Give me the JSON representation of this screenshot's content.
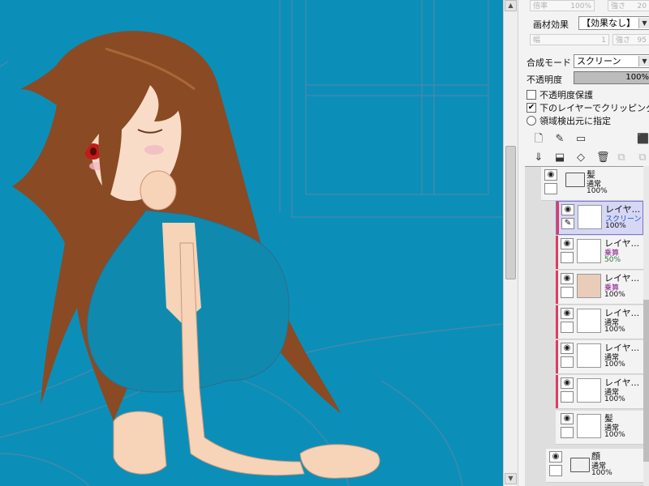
{
  "window": {
    "bg_color": "#0b8fb8"
  },
  "panel": {
    "top_labels": {
      "bairitsu": "倍率",
      "bairitsu_val": "100%",
      "tsuyosa": "強さ",
      "tsuyosa_val": "20"
    },
    "texture_effect": {
      "label": "画材効果",
      "value": "【効果なし】"
    },
    "width_row": {
      "haba": "幅",
      "haba_val": "1",
      "tsuyosa": "強さ",
      "tsuyosa_val": "95"
    },
    "blend_mode": {
      "label": "合成モード",
      "value": "スクリーン"
    },
    "opacity": {
      "label": "不透明度",
      "value": "100%"
    },
    "opts": {
      "protect": {
        "label": "不透明度保護",
        "checked": ""
      },
      "clip": {
        "label": "下のレイヤーでクリッピング",
        "checked": "✔"
      },
      "source": {
        "label": "領域検出元に指定"
      }
    },
    "layers": [
      {
        "name": "髪",
        "mode": "通常",
        "opacity": "100%",
        "type": "folder"
      },
      {
        "name": "レイヤ...",
        "mode": "スクリーン",
        "opacity": "100%",
        "type": "layer",
        "selected": true,
        "mode_color": "#1a4fd6"
      },
      {
        "name": "レイヤ...",
        "mode": "乗算",
        "opacity": "50%",
        "type": "layer",
        "mode_color": "#8a1c8a",
        "op_color": "#1f7a3a"
      },
      {
        "name": "レイヤ...",
        "mode": "乗算",
        "opacity": "100%",
        "type": "layer",
        "mode_color": "#8a1c8a"
      },
      {
        "name": "レイヤ...",
        "mode": "通常",
        "opacity": "100%",
        "type": "layer"
      },
      {
        "name": "レイヤ...",
        "mode": "通常",
        "opacity": "100%",
        "type": "layer"
      },
      {
        "name": "レイヤ...",
        "mode": "通常",
        "opacity": "100%",
        "type": "layer"
      },
      {
        "name": "髪",
        "mode": "通常",
        "opacity": "100%",
        "type": "layer"
      },
      {
        "name": "顔",
        "mode": "通常",
        "opacity": "100%",
        "type": "folder"
      }
    ]
  }
}
